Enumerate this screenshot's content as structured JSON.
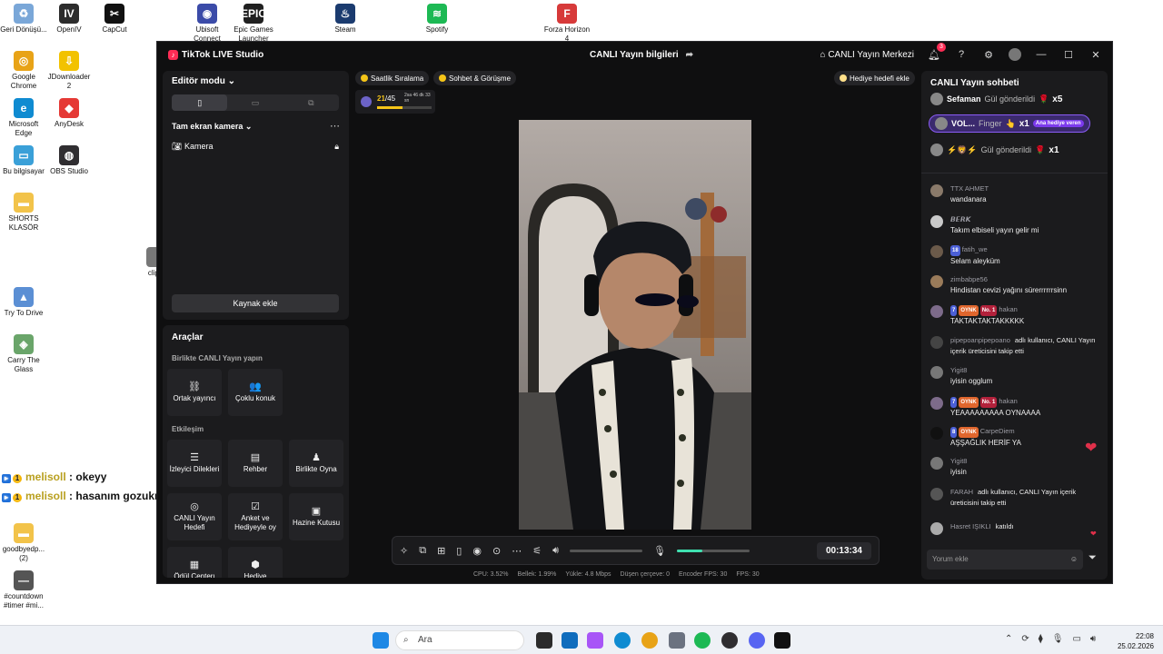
{
  "desktop": {
    "icons": [
      {
        "name": "recycle-bin-icon",
        "label": "Geri Dönüşü...",
        "color": "#7aa7d8",
        "glyph": "♻"
      },
      {
        "name": "openiv-icon",
        "label": "OpenIV",
        "color": "#2c2c2c",
        "glyph": "IV"
      },
      {
        "name": "capcut-icon",
        "label": "CapCut",
        "color": "#111111",
        "glyph": "✂"
      },
      {
        "name": "ubisoft-connect-icon",
        "label": "Ubisoft Connect",
        "color": "#3b4ba8",
        "glyph": "◉"
      },
      {
        "name": "epic-games-icon",
        "label": "Epic Games Launcher",
        "color": "#202020",
        "glyph": "EPIC"
      },
      {
        "name": "steam-icon",
        "label": "Steam",
        "color": "#1b3b6f",
        "glyph": "♨"
      },
      {
        "name": "spotify-icon",
        "label": "Spotify",
        "color": "#1db954",
        "glyph": "≋"
      },
      {
        "name": "forza-horizon-icon",
        "label": "Forza Horizon 4",
        "color": "#d73a3a",
        "glyph": "F"
      },
      {
        "name": "chrome-icon",
        "label": "Google Chrome",
        "color": "#e8a317",
        "glyph": "◎"
      },
      {
        "name": "jdownloader-icon",
        "label": "JDownloader 2",
        "color": "#f2c200",
        "glyph": "⇩"
      },
      {
        "name": "edge-icon",
        "label": "Microsoft Edge",
        "color": "#0f8bd1",
        "glyph": "e"
      },
      {
        "name": "anydesk-icon",
        "label": "AnyDesk",
        "color": "#e53935",
        "glyph": "◆"
      },
      {
        "name": "this-pc-icon",
        "label": "Bu bilgisayar",
        "color": "#3aa0d8",
        "glyph": "▭"
      },
      {
        "name": "obs-studio-icon",
        "label": "OBS Studio",
        "color": "#302e31",
        "glyph": "◍"
      },
      {
        "name": "shorts-folder-icon",
        "label": "SHORTS KLASÖR",
        "color": "#f2c34a",
        "glyph": "▬"
      },
      {
        "name": "clip-file-icon",
        "label": "clip_l",
        "color": "#777777",
        "glyph": ""
      },
      {
        "name": "try-to-drive-icon",
        "label": "Try To Drive",
        "color": "#5b8fd4",
        "glyph": "▲"
      },
      {
        "name": "carry-the-glass-icon",
        "label": "Carry The Glass",
        "color": "#6aa56a",
        "glyph": "◈"
      },
      {
        "name": "goodbyedp-folder-icon",
        "label": "goodbyedp... (2)",
        "color": "#f2c34a",
        "glyph": "▬"
      },
      {
        "name": "countdown-file-icon",
        "label": "#countdown #timer #mi...",
        "color": "#555555",
        "glyph": "—"
      }
    ],
    "overlay": [
      {
        "user": "melisoll",
        "text": ": okeyy"
      },
      {
        "user": "melisoll",
        "text": ": hasanım gozukmuyo yazdıgın bende"
      }
    ]
  },
  "app": {
    "title": "TikTok LIVE Studio",
    "center_title": "CANLI Yayın bilgileri",
    "live_center": "CANLI Yayın Merkezi",
    "notifications": "3"
  },
  "editor": {
    "title": "Editör modu",
    "camera_scene": "Tam ekran kamera",
    "source": "Kamera",
    "add_source": "Kaynak ekle"
  },
  "tools": {
    "title": "Araçlar",
    "section_collab": "Birlikte CANLI Yayın yapın",
    "collab": [
      {
        "icon": "link-icon",
        "glyph": "⛓",
        "label": "Ortak yayıncı"
      },
      {
        "icon": "multi-guest-icon",
        "glyph": "👥",
        "label": "Çoklu konuk"
      }
    ],
    "section_engage": "Etkileşim",
    "engage": [
      {
        "icon": "viewer-requests-icon",
        "glyph": "☰",
        "label": "İzleyici Dilekleri"
      },
      {
        "icon": "guide-icon",
        "glyph": "▤",
        "label": "Rehber"
      },
      {
        "icon": "play-together-icon",
        "glyph": "♟",
        "label": "Birlikte Oyna"
      },
      {
        "icon": "live-goal-icon",
        "glyph": "◎",
        "label": "CANLI Yayın Hedefi"
      },
      {
        "icon": "poll-icon",
        "glyph": "☑",
        "label": "Anket ve Hediyeyle oy"
      },
      {
        "icon": "treasure-box-icon",
        "glyph": "▣",
        "label": "Hazine Kutusu"
      },
      {
        "icon": "reward-icon",
        "glyph": "▦",
        "label": "Ödül Centerı"
      },
      {
        "icon": "gift-icon",
        "glyph": "⬢",
        "label": "Hediye"
      }
    ]
  },
  "center": {
    "pill_hourly": "Saatlik Sıralama",
    "pill_chat": "Sohbet & Görüşme",
    "gift_goal": "Hediye hedefi ekle",
    "rank_current": "21",
    "rank_total": "/45",
    "rank_time": "2sa 46 dk 33 sn",
    "rank_progress": 0.47,
    "timer": "00:13:34",
    "volume_level": 0.0,
    "mic_level": 0.35,
    "stats": {
      "cpu": "CPU: 3.52%",
      "memory": "Bellek: 1.99%",
      "upload": "Yükle: 4.8 Mbps",
      "dropped": "Düşen çerçeve: 0",
      "encoder_fps": "Encoder FPS: 30",
      "fps": "FPS: 30"
    }
  },
  "chat": {
    "title": "CANLI Yayın sohbeti",
    "gifts": [
      {
        "user": "Sefaman",
        "action": "Gül gönderildi",
        "count": "x5"
      },
      {
        "user": "VOL...",
        "action": "Finger",
        "count": "x1",
        "badge": "Ana hediye veren"
      },
      {
        "user": "⚡🦁⚡",
        "action": "Gül gönderildi",
        "count": "x1"
      }
    ],
    "messages": [
      {
        "user": "TTX AHMET",
        "text": "wandanara",
        "badges": []
      },
      {
        "user": "𝘽𝙀𝙍𝙆",
        "text": "Takım elbiseli yayın gelir mi",
        "badges": []
      },
      {
        "user": "fatih_we",
        "text": "Selam aleyküm",
        "badges": [
          "18"
        ]
      },
      {
        "user": "zimbabpe56",
        "text": "Hindistan cevizi yağını sürerrrrrrsinn",
        "badges": []
      },
      {
        "user": "hakan",
        "text": "TAKTAKTAKTAKKKKK",
        "badges": [
          "7",
          "OYNK",
          "No. 1"
        ]
      },
      {
        "user": "pipepoanpipepoano",
        "text": "adlı kullanıcı, CANLI Yayın içerik üreticisini takip etti",
        "badges": []
      },
      {
        "user": "Yigit8",
        "text": "iyisin ogglum",
        "badges": []
      },
      {
        "user": "hakan",
        "text": "YEAAAAAAAAA OYNAAAA",
        "badges": [
          "7",
          "OYNK",
          "No. 1"
        ]
      },
      {
        "user": "CarpeDiem",
        "text": "AŞŞAĞLIK HERİF YA",
        "badges": [
          "8",
          "OYNK"
        ]
      },
      {
        "user": "Yigit8",
        "text": "iyisin",
        "badges": []
      },
      {
        "user": "FARAH",
        "text": "adlı kullanıcı, CANLI Yayın içerik üreticisini takip etti",
        "badges": []
      },
      {
        "user": "Hasret IŞIKLI",
        "text": "katıldı",
        "badges": []
      }
    ],
    "input_placeholder": "Yorum ekle"
  },
  "taskbar": {
    "search": "Ara",
    "time": "22:08",
    "date": "25.02.2026"
  },
  "colors": {
    "accent": "#fe2c55",
    "mic_level": "#3fe0b0",
    "gold": "#f5c518",
    "highlight_gift": "#7c3aed"
  }
}
